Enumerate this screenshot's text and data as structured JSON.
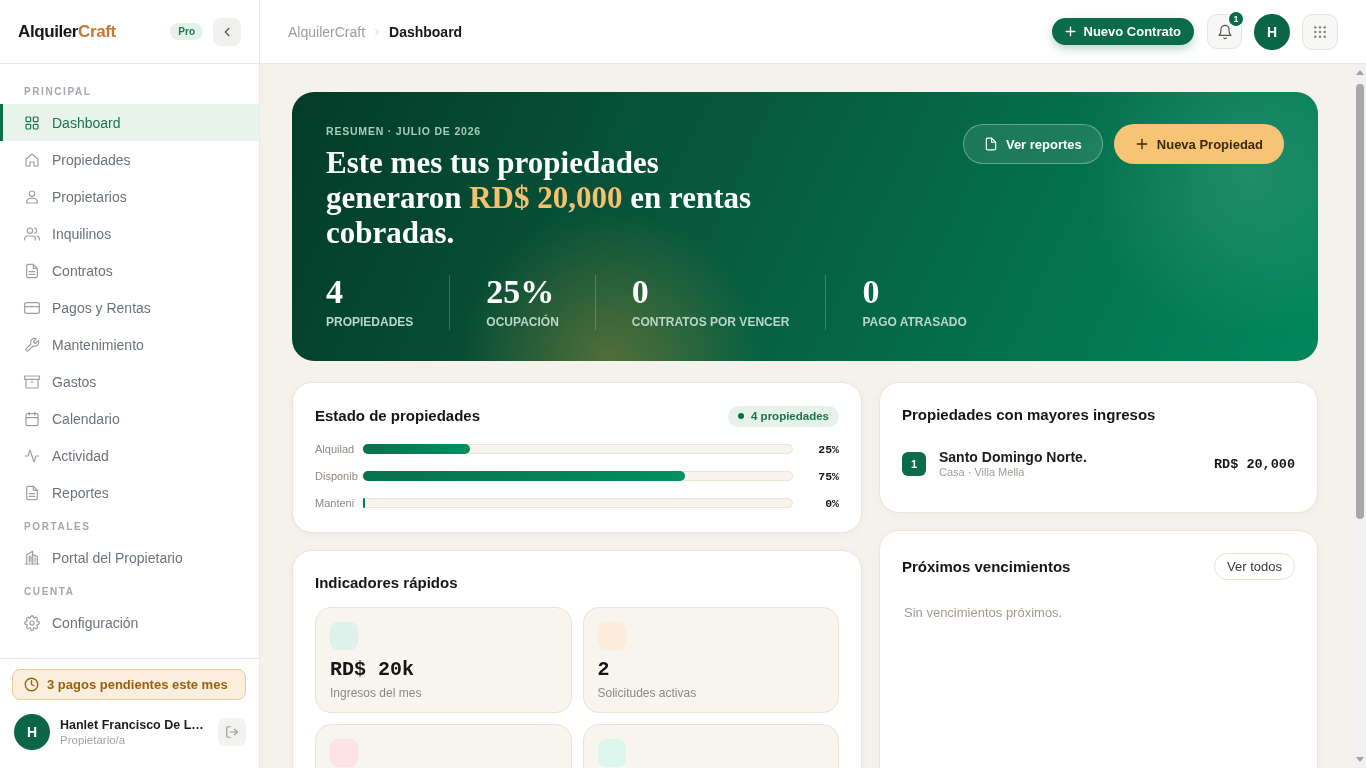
{
  "sidebar": {
    "logo": {
      "text": "Alquiler",
      "accent": "Craft"
    },
    "plan_badge": "Pro",
    "sections": [
      {
        "title": "PRINCIPAL",
        "items": [
          {
            "label": "Dashboard",
            "selected": true
          },
          {
            "label": "Propiedades",
            "selected": false
          },
          {
            "label": "Propietarios",
            "selected": false
          },
          {
            "label": "Inquilinos",
            "selected": false
          },
          {
            "label": "Contratos",
            "selected": false
          },
          {
            "label": "Pagos y Rentas",
            "selected": false
          },
          {
            "label": "Mantenimiento",
            "selected": false
          },
          {
            "label": "Gastos",
            "selected": false
          },
          {
            "label": "Calendario",
            "selected": false
          },
          {
            "label": "Actividad",
            "selected": false
          },
          {
            "label": "Reportes",
            "selected": false
          }
        ]
      },
      {
        "title": "PORTALES",
        "items": [
          {
            "label": "Portal del Propietario",
            "selected": false
          }
        ]
      },
      {
        "title": "CUENTA",
        "items": [
          {
            "label": "Configuración",
            "selected": false
          }
        ]
      }
    ],
    "alert": "3 pagos pendientes este mes",
    "user": {
      "initial": "H",
      "name": "Hanlet Francisco De L…",
      "role": "Propietario/a"
    }
  },
  "topbar": {
    "breadcrumb": [
      "AlquilerCraft",
      "Dashboard"
    ],
    "new_contract_button": "Nuevo Contrato",
    "notifications": "1",
    "avatar_initial": "H"
  },
  "hero": {
    "eyebrow": "RESUMEN · JULIO DE 2026",
    "headline": "Este mes tus propiedades generaron **RD$ 20,000** en rentas cobradas.",
    "buttons": [
      {
        "kind": "outline",
        "label": "Ver reportes"
      },
      {
        "kind": "primary",
        "label": "Nueva Propiedad"
      }
    ],
    "stats": [
      {
        "value": "4",
        "label": "PROPIEDADES"
      },
      {
        "value": "25%",
        "label": "OCUPACIÓN"
      },
      {
        "value": "0",
        "label": "CONTRATOS POR VENCER"
      },
      {
        "value": "0",
        "label": "PAGO ATRASADO"
      }
    ]
  },
  "property_status": {
    "title": "Estado de propiedades",
    "badge": "4 propiedades",
    "rows": [
      {
        "label": "Alquilad",
        "level": 0.25,
        "reading": "25%"
      },
      {
        "label": "Disponib",
        "level": 0.75,
        "reading": "75%"
      },
      {
        "label": "Manteni",
        "level": 0,
        "reading": "0%"
      }
    ]
  },
  "quick_indicators": {
    "title": "Indicadores rápidos",
    "tiles": [
      {
        "color": "#dff1ea",
        "value": "RD$ 20k",
        "label": "Ingresos del mes"
      },
      {
        "color": "#fbecdc",
        "value": "2",
        "label": "Solicitudes activas"
      },
      {
        "color": "#fde3e4"
      },
      {
        "color": "#dcf6ee"
      }
    ]
  },
  "top_income": {
    "title": "Propiedades con mayores ingresos",
    "items": [
      {
        "rank": "1",
        "name": "Santo Domingo Norte.",
        "detail": "Casa · Villa Mella",
        "amount": "RD$ 20,000"
      }
    ]
  },
  "upcoming": {
    "title": "Próximos vencimientos",
    "button": "Ver todos",
    "empty": "Sin vencimientos próximos."
  }
}
